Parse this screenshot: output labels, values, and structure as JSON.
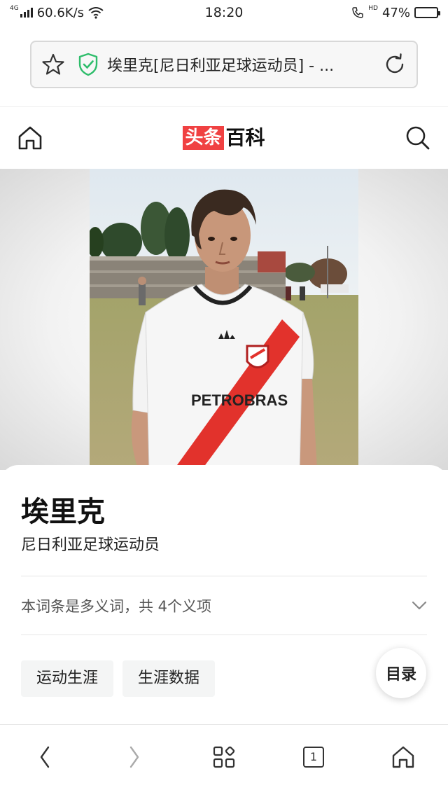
{
  "status_bar": {
    "network": "4G",
    "speed": "60.6K/s",
    "time": "18:20",
    "hd": "HD",
    "battery": "47%",
    "battery_level": 0.47
  },
  "url_bar": {
    "title": "埃里克[尼日利亚足球运动员] - ..."
  },
  "site": {
    "logo_red": "头条",
    "logo_black": "百科"
  },
  "article": {
    "title": "埃里克",
    "subtitle": "尼日利亚足球运动员",
    "polysemy_text": "本词条是多义词，共 4个义项",
    "chips": [
      "运动生涯",
      "生涯数据"
    ],
    "toc_label": "目录"
  },
  "hero": {
    "jersey_text": "PETROBRAS"
  },
  "bottom_nav": {
    "tab_count": "1"
  },
  "colors": {
    "brand_red": "#f04142",
    "jersey_red": "#e2322c"
  }
}
